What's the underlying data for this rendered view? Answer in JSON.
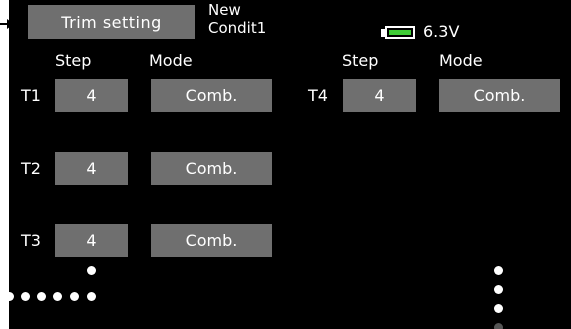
{
  "header": {
    "title_button": "Trim setting",
    "condition_line1": "New",
    "condition_line2": "Condit1",
    "battery": {
      "voltage": "6.3V",
      "level": 1.0,
      "fill_color": "#3fcc35"
    }
  },
  "columns": {
    "step_label": "Step",
    "mode_label": "Mode"
  },
  "trims": [
    {
      "name": "T1",
      "step": "4",
      "mode": "Comb."
    },
    {
      "name": "T2",
      "step": "4",
      "mode": "Comb."
    },
    {
      "name": "T3",
      "step": "4",
      "mode": "Comb."
    },
    {
      "name": "T4",
      "step": "4",
      "mode": "Comb."
    }
  ],
  "colors": {
    "background": "#000000",
    "button": "#6f6f6f",
    "text": "#ffffff"
  },
  "icons": {
    "pointer": "arrow-right-icon",
    "battery": "battery-icon",
    "dots": "scroll-dots-icon"
  }
}
